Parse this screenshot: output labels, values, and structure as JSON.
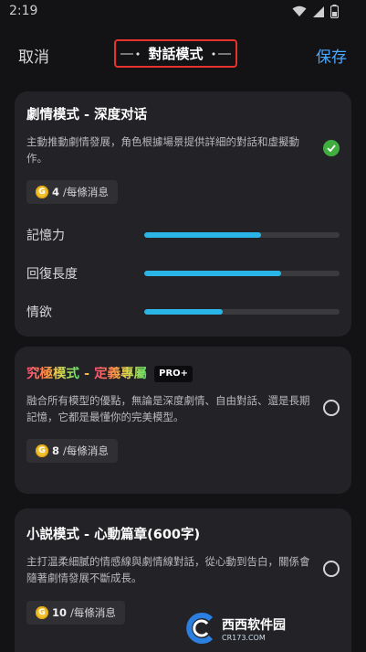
{
  "status_bar": {
    "time": "2:19"
  },
  "header": {
    "cancel_label": "取消",
    "title": "對話模式",
    "save_label": "保存"
  },
  "cards": [
    {
      "title": "劇情模式 - 深度对话",
      "description": "主動推動劇情發展，角色根據場景提供詳細的對話和虛擬動作。",
      "price_value": "4",
      "price_unit": "/每條消息",
      "selected": true,
      "stats": [
        {
          "label": "記憶力",
          "value": 0.6
        },
        {
          "label": "回復長度",
          "value": 0.7
        },
        {
          "label": "情欲",
          "value": 0.4
        }
      ]
    },
    {
      "title_prefix": "究極模式",
      "title_separator": " - ",
      "title_suffix": "定義專屬",
      "badge": "PRO+",
      "description": "融合所有模型的優點，無論是深度劇情、自由對話、還是長期記憶，它都是最懂你的完美模型。",
      "price_value": "8",
      "price_unit": "/每條消息",
      "selected": false
    },
    {
      "title": "小説模式 - 心動篇章(600字)",
      "description": "主打温柔細膩的情感線與劇情線對話，從心動到告白，關係會隨著劇情發展不斷成長。",
      "price_value": "10",
      "price_unit": "/每條消息",
      "selected": false
    }
  ],
  "coin_glyph": "G",
  "colors": {
    "accent": "#4aa8ff",
    "bar_fill": "#2ab5e6",
    "check_green": "#3fae3f",
    "highlight_box": "#e5322d"
  },
  "watermark": {
    "brand": "西西软件园",
    "url": "CR173.COM"
  }
}
